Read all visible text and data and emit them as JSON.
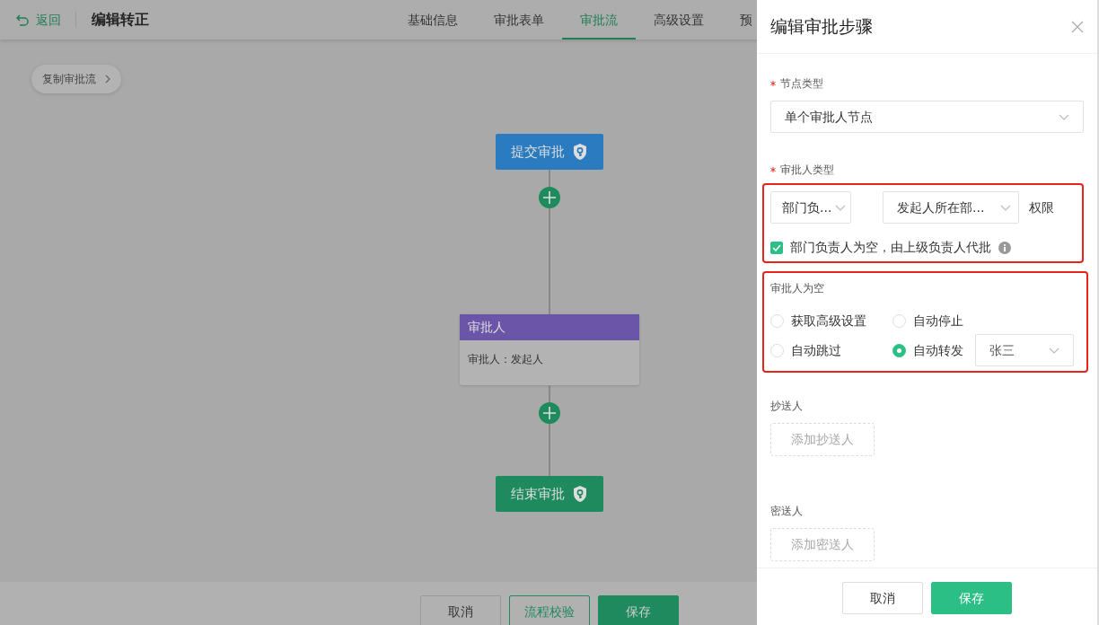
{
  "header": {
    "back": "返回",
    "title": "编辑转正",
    "tabs": [
      {
        "label": "基础信息",
        "selected": false
      },
      {
        "label": "审批表单",
        "selected": false
      },
      {
        "label": "审批流",
        "selected": true
      },
      {
        "label": "高级设置",
        "selected": false
      },
      {
        "label": "预",
        "selected": false
      }
    ]
  },
  "copy_button": "复制审批流",
  "flow": [
    {
      "kind": "start",
      "label": "提交审批"
    },
    {
      "kind": "add"
    },
    {
      "kind": "approver",
      "title": "审批人",
      "body": "审批人：发起人"
    },
    {
      "kind": "add"
    },
    {
      "kind": "end",
      "label": "结束审批"
    }
  ],
  "footer_buttons": [
    {
      "label": "取消",
      "kind": "default"
    },
    {
      "label": "流程校验",
      "kind": "outline"
    },
    {
      "label": "保存",
      "kind": "primary"
    }
  ],
  "drawer": {
    "title": "编辑审批步骤",
    "node_type": {
      "label": "节点类型",
      "required": true,
      "value": "单个审批人节点"
    },
    "approver_type": {
      "label": "审批人类型",
      "required": true,
      "highlighted": true,
      "selects": [
        "部门负...",
        "发起人所在部..."
      ],
      "suffix": "权限",
      "checkbox": {
        "label": "部门负责人为空，由上级负责人代批",
        "checked": true
      }
    },
    "empty_approver": {
      "label": "审批人为空",
      "highlighted": true,
      "options": [
        {
          "label": "获取高级设置",
          "selected": false
        },
        {
          "label": "自动停止",
          "selected": false
        },
        {
          "label": "自动跳过",
          "selected": false
        },
        {
          "label": "自动转发",
          "selected": true
        }
      ],
      "forward_to": "张三"
    },
    "cc": {
      "label": "抄送人",
      "button": "添加抄送人"
    },
    "bcc": {
      "label": "密送人",
      "button": "添加密送人"
    },
    "buttons": [
      {
        "label": "取消",
        "kind": "default"
      },
      {
        "label": "保存",
        "kind": "primary"
      }
    ]
  }
}
